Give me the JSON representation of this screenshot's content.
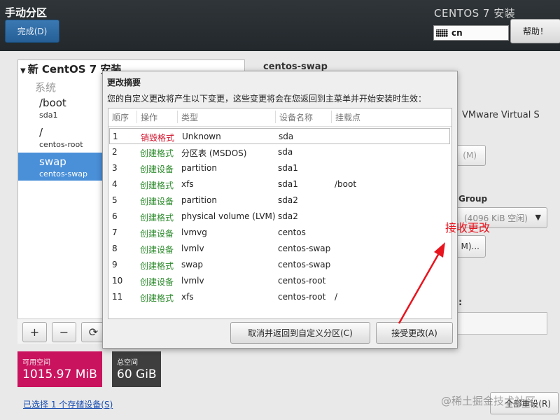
{
  "header": {
    "page_title": "手动分区",
    "done_button": "完成(D)",
    "install_title": "CENTOS 7 安装",
    "keyboard_layout": "cn",
    "help_button": "帮助！"
  },
  "left_panel": {
    "tree_title": "新 CentOS 7 安装",
    "group_label": "系统",
    "mounts": [
      {
        "name": "/boot",
        "device": "sda1",
        "selected": false
      },
      {
        "name": "/",
        "device": "centos-root",
        "selected": false
      },
      {
        "name": "swap",
        "device": "centos-swap",
        "selected": true
      }
    ],
    "toolbar": {
      "add": "+",
      "remove": "−",
      "refresh": "⟳"
    },
    "available_space": {
      "label": "可用空间",
      "value": "1015.97 MiB"
    },
    "total_space": {
      "label": "总空间",
      "value": "60 GiB"
    },
    "storage_link": "已选择 1 个存储设备(S)"
  },
  "right_panel": {
    "title": "centos-swap",
    "device_desc": "VMware Virtual S",
    "modify_btn_1": "(M)",
    "group_label": "Group",
    "volume_group_select": "(4096 KiB 空闲)",
    "modify_btn_2": "M)...",
    "field_label": ":",
    "reset_button": "全部重设(R)"
  },
  "modal": {
    "title": "更改摘要",
    "description": "您的自定义更改将产生以下变更，这些变更将会在您返回到主菜单并开始安装时生效：",
    "columns": [
      "顺序",
      "操作",
      "类型",
      "设备名称",
      "挂载点"
    ],
    "rows": [
      {
        "order": "1",
        "action": "销毁格式",
        "type": "Unknown",
        "device": "sda",
        "mount": ""
      },
      {
        "order": "2",
        "action": "创建格式",
        "type": "分区表 (MSDOS)",
        "device": "sda",
        "mount": ""
      },
      {
        "order": "3",
        "action": "创建设备",
        "type": "partition",
        "device": "sda1",
        "mount": ""
      },
      {
        "order": "4",
        "action": "创建格式",
        "type": "xfs",
        "device": "sda1",
        "mount": "/boot"
      },
      {
        "order": "5",
        "action": "创建设备",
        "type": "partition",
        "device": "sda2",
        "mount": ""
      },
      {
        "order": "6",
        "action": "创建格式",
        "type": "physical volume (LVM)",
        "device": "sda2",
        "mount": ""
      },
      {
        "order": "7",
        "action": "创建设备",
        "type": "lvmvg",
        "device": "centos",
        "mount": ""
      },
      {
        "order": "8",
        "action": "创建设备",
        "type": "lvmlv",
        "device": "centos-swap",
        "mount": ""
      },
      {
        "order": "9",
        "action": "创建格式",
        "type": "swap",
        "device": "centos-swap",
        "mount": ""
      },
      {
        "order": "10",
        "action": "创建设备",
        "type": "lvmlv",
        "device": "centos-root",
        "mount": ""
      },
      {
        "order": "11",
        "action": "创建格式",
        "type": "xfs",
        "device": "centos-root",
        "mount": "/"
      }
    ],
    "cancel_button": "取消并返回到自定义分区(C)",
    "accept_button": "接受更改(A)"
  },
  "annotation": {
    "text": "接收更改",
    "color": "#e8141e"
  },
  "watermark": "@稀土掘金技术社区",
  "colors": {
    "header_bg": "#2a3033",
    "accent_blue": "#4a90d9",
    "available_bg": "#c9135e",
    "total_bg": "#3e3e3e",
    "create_green": "#2e8b2e",
    "destroy_red": "#d0142c"
  }
}
